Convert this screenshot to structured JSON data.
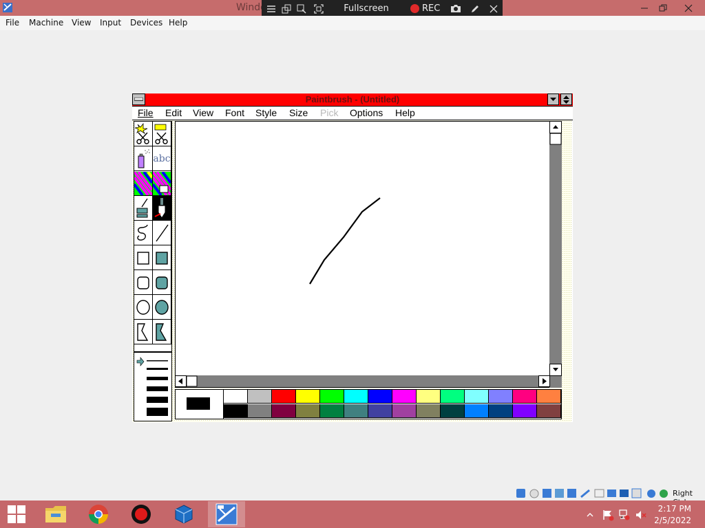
{
  "host": {
    "title": "Windo",
    "menus": [
      "File",
      "Machine",
      "View",
      "Input",
      "Devices",
      "Help"
    ],
    "colors": {
      "titlebar": "#c66c6c",
      "taskbar": "#c5676a"
    }
  },
  "vbox_toolbar": {
    "fullscreen_label": "Fullscreen",
    "rec_label": "REC"
  },
  "paint": {
    "title": "Paintbrush - (Untitled)",
    "menus": [
      {
        "label": "File",
        "enabled": true
      },
      {
        "label": "Edit",
        "enabled": true
      },
      {
        "label": "View",
        "enabled": true
      },
      {
        "label": "Font",
        "enabled": true
      },
      {
        "label": "Style",
        "enabled": true
      },
      {
        "label": "Size",
        "enabled": true
      },
      {
        "label": "Pick",
        "enabled": false
      },
      {
        "label": "Options",
        "enabled": true
      },
      {
        "label": "Help",
        "enabled": true
      }
    ],
    "tools": [
      "scissors-pick-icon",
      "scissors-icon",
      "airbrush-icon",
      "text-tool-icon",
      "color-eraser-icon",
      "eraser-icon",
      "paint-roller-icon",
      "brush-icon",
      "curve-icon",
      "line-icon",
      "box-icon",
      "filled-box-icon",
      "rounded-box-icon",
      "filled-rounded-box-icon",
      "circle-icon",
      "filled-circle-icon",
      "polygon-icon",
      "filled-polygon-icon"
    ],
    "tool_text": "abc",
    "selected_tool": "brush-icon",
    "foreground": "#000000",
    "background": "#ffffff",
    "palette_top": [
      "#ffffff",
      "#c0c0c0",
      "#ff0000",
      "#ffff00",
      "#00ff00",
      "#00ffff",
      "#0000ff",
      "#ff00ff",
      "#ffff80",
      "#00ff80",
      "#80ffff",
      "#8080ff",
      "#ff0080",
      "#ff8040"
    ],
    "palette_bottom": [
      "#000000",
      "#808080",
      "#800040",
      "#808040",
      "#008040",
      "#408080",
      "#4040a0",
      "#a040a0",
      "#808060",
      "#004040",
      "#0080ff",
      "#004080",
      "#8000ff",
      "#804040"
    ]
  },
  "tray": {
    "status_text": "Right Ctrl",
    "time": "2:17 PM",
    "date": "2/5/2022"
  }
}
